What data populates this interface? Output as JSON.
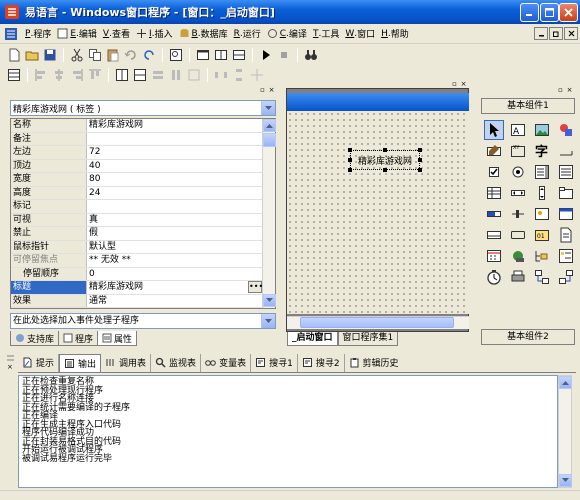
{
  "window": {
    "title": "易语言 - Windows窗口程序 - [窗口：_启动窗口]"
  },
  "menu": [
    {
      "key": "P",
      "label": "程序"
    },
    {
      "key": "E",
      "label": "编辑"
    },
    {
      "key": "V",
      "label": "查看"
    },
    {
      "key": "I",
      "label": "插入"
    },
    {
      "key": "B",
      "label": "数据库"
    },
    {
      "key": "R",
      "label": "运行"
    },
    {
      "key": "C",
      "label": "编译"
    },
    {
      "key": "T",
      "label": "工具"
    },
    {
      "key": "W",
      "label": "窗口"
    },
    {
      "key": "H",
      "label": "帮助"
    }
  ],
  "properties": {
    "object_selector": "精彩库游戏网 ( 标签 )",
    "rows": [
      {
        "name": "名称",
        "value": "精彩库游戏网"
      },
      {
        "name": "备注",
        "value": ""
      },
      {
        "name": "左边",
        "value": "72"
      },
      {
        "name": "顶边",
        "value": "40"
      },
      {
        "name": "宽度",
        "value": "80"
      },
      {
        "name": "高度",
        "value": "24"
      },
      {
        "name": "标记",
        "value": ""
      },
      {
        "name": "可视",
        "value": "真"
      },
      {
        "name": "禁止",
        "value": "假"
      },
      {
        "name": "鼠标指针",
        "value": "默认型"
      },
      {
        "name": "可停留焦点",
        "value": "** 无效 **"
      },
      {
        "name": "停留顺序",
        "value": "0"
      },
      {
        "name": "标题",
        "value": "精彩库游戏网"
      },
      {
        "name": "效果",
        "value": "通常"
      }
    ],
    "event_selector": "在此处选择加入事件处理子程序",
    "tabs": [
      "支持库",
      "程序",
      "属性"
    ]
  },
  "designer": {
    "label_text": "精彩库游戏网",
    "tabs": [
      "_启动窗口",
      "窗口程序集1"
    ]
  },
  "palette": {
    "header": "基本组件1",
    "footer": "基本组件2"
  },
  "bottom": {
    "tabs": [
      "提示",
      "输出",
      "调用表",
      "监视表",
      "变量表",
      "搜寻1",
      "搜寻2",
      "剪辑历史"
    ],
    "output_lines": [
      "正在检查重复名称",
      "正在预处理现行程序",
      "正在进行名称连接",
      "正在统计需要编译的子程序",
      "正在编译",
      "正在生成主程序入口代码",
      "程序代码编译成功",
      "正在封装易格式目的代码",
      "开始运行被调试程序",
      "被调试易程序运行完毕"
    ]
  },
  "colors": {
    "titlebar": "#0A5FD8",
    "selection": "#316AC5",
    "chrome": "#ECE9D8"
  }
}
